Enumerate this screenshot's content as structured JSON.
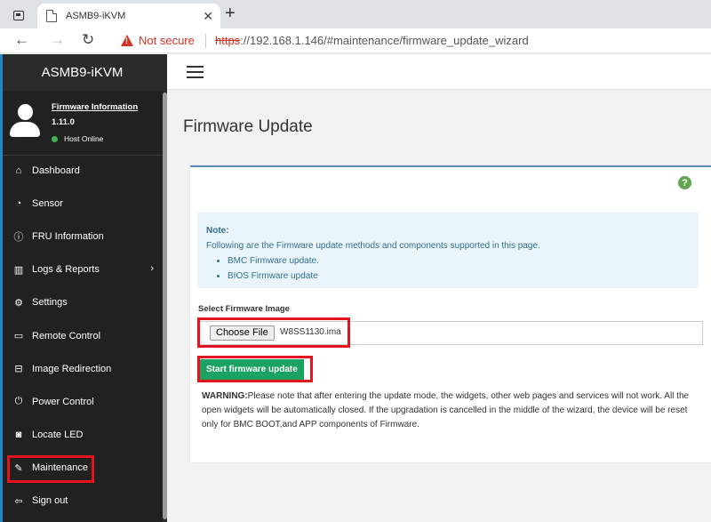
{
  "browser": {
    "tab_title": "ASMB9-iKVM",
    "not_secure": "Not secure",
    "url_proto": "https",
    "url_rest": "://192.168.1.146/#maintenance/firmware_update_wizard"
  },
  "sidebar": {
    "brand": "ASMB9-iKVM",
    "firmware_link": "Firmware Information",
    "firmware_version": "1.11.0",
    "host_status": "Host Online",
    "items": [
      {
        "label": "Dashboard",
        "icon": "dashboard-icon"
      },
      {
        "label": "Sensor",
        "icon": "sensor-icon"
      },
      {
        "label": "FRU Information",
        "icon": "info-icon"
      },
      {
        "label": "Logs & Reports",
        "icon": "chart-icon"
      },
      {
        "label": "Settings",
        "icon": "gear-icon"
      },
      {
        "label": "Remote Control",
        "icon": "monitor-icon"
      },
      {
        "label": "Image Redirection",
        "icon": "disk-icon"
      },
      {
        "label": "Power Control",
        "icon": "power-icon"
      },
      {
        "label": "Locate LED",
        "icon": "camera-icon"
      },
      {
        "label": "Maintenance",
        "icon": "wrench-icon"
      },
      {
        "label": "Sign out",
        "icon": "signout-icon"
      }
    ]
  },
  "main": {
    "page_title": "Firmware Update",
    "note_title": "Note:",
    "note_text": "Following are the Firmware update methods and components supported in this page.",
    "note_items": [
      "BMC Firmware update.",
      "BIOS Firmware update"
    ],
    "select_label": "Select Firmware Image",
    "choose_file": "Choose File",
    "file_name": "W8SS1130.ima",
    "start_button": "Start firmware update",
    "warning_label": "WARNING:",
    "warning_text": "Please note that after entering the update mode, the widgets, other web pages and services will not work. All the open widgets will be automatically closed. If the upgradation is cancelled in the middle of the wizard, the device will be reset only for BMC BOOT,and APP components of Firmware."
  },
  "colors": {
    "sidebar_bg": "#212121",
    "accent_blue": "#1e88c7",
    "success_green": "#1aa262",
    "highlight_red": "#e3141d",
    "note_text": "#31708f"
  }
}
